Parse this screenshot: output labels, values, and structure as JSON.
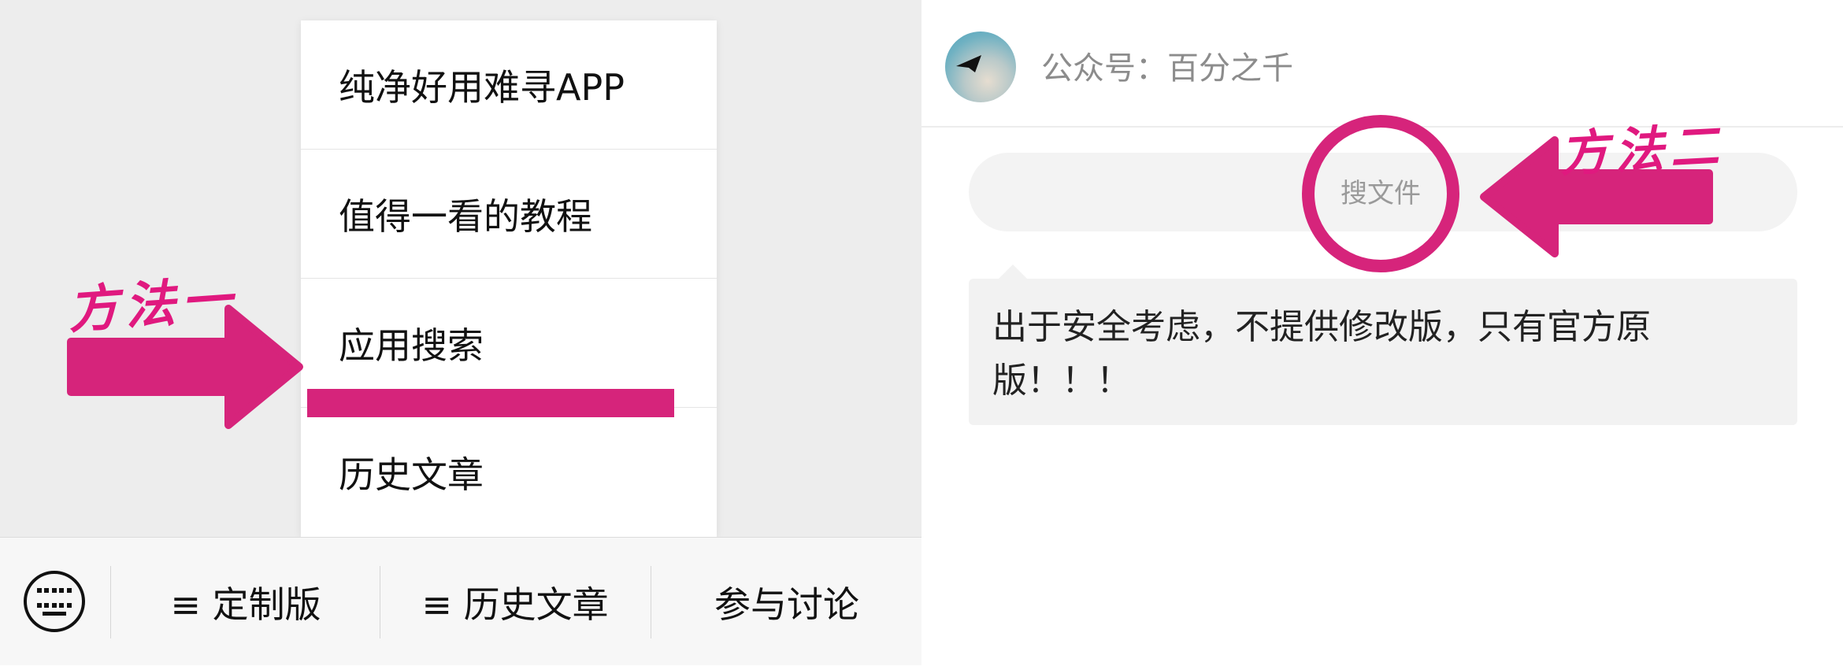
{
  "colors": {
    "accent": "#d6247b"
  },
  "menu": {
    "items": [
      {
        "label": "纯净好用难寻APP"
      },
      {
        "label": "值得一看的教程"
      },
      {
        "label": "应用搜索"
      },
      {
        "label": "历史文章"
      }
    ]
  },
  "bottom_bar": {
    "keyboard_icon": "keyboard-icon",
    "tabs": [
      {
        "label": "≡ 定制版"
      },
      {
        "label": "≡ 历史文章"
      },
      {
        "label": "参与讨论"
      }
    ]
  },
  "annotations": {
    "method_one": "方法一",
    "method_two": "方法二"
  },
  "chat": {
    "header_title": "公众号：百分之千",
    "search_label": "搜文件",
    "message": "出于安全考虑，不提供修改版，只有官方原版！！！"
  }
}
